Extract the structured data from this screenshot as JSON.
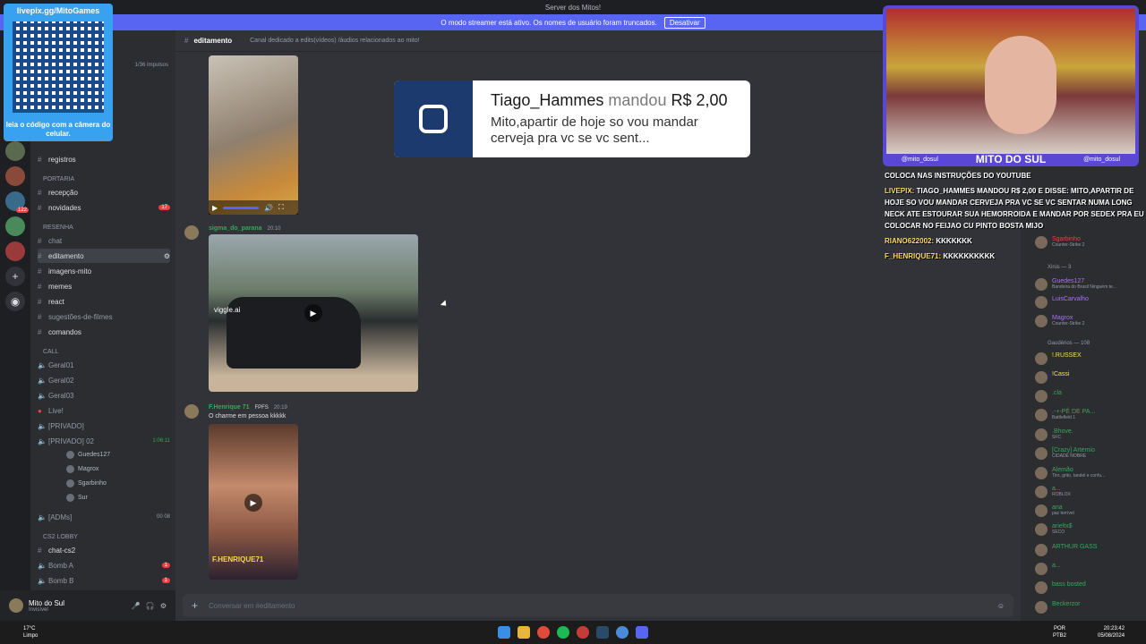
{
  "window": {
    "title": "Server dos Mitos!"
  },
  "banner": {
    "text": "O modo streamer está ativo. Os nomes de usuário foram truncados.",
    "button": "Desativar"
  },
  "header": {
    "channel": "editamento",
    "description": "Canal dedicado a edits(vídeos) /áudios relacionados ao mito!"
  },
  "sidebar": {
    "boosts": "1/36 Impulsos",
    "channels": [
      {
        "name": "registros"
      },
      {
        "category": "PORTARIA"
      },
      {
        "name": "recepção"
      },
      {
        "name": "novidades",
        "badge": "17"
      },
      {
        "category": "RESENHA"
      },
      {
        "name": "chat"
      },
      {
        "name": "editamento"
      },
      {
        "name": "imagens-mito"
      },
      {
        "name": "memes"
      },
      {
        "name": "react"
      },
      {
        "name": "sugestões-de-filmes"
      },
      {
        "name": "comandos"
      },
      {
        "category": "CALL"
      },
      {
        "name": "Geral01"
      },
      {
        "name": "Geral02"
      },
      {
        "name": "Geral03"
      },
      {
        "name": "Live!"
      },
      {
        "name": "[PRIVADO]"
      },
      {
        "name": "[PRIVADO] 02",
        "timer": "1:06:11"
      },
      {
        "name": "[ADMs]",
        "timer": "00 08"
      },
      {
        "category": "CS2 LOBBY"
      },
      {
        "name": "chat-cs2"
      },
      {
        "name": "Bomb A"
      },
      {
        "name": "Bomb B"
      }
    ],
    "voice_users": [
      "Guedes127",
      "Magrox",
      "Sgarbinho",
      "Sur"
    ]
  },
  "messages": [
    {
      "author": "sigma_do_parana",
      "time": "20:10",
      "text": "",
      "watermark": "viggle.ai"
    },
    {
      "author": "F.Henrique 71",
      "tag": "FPFS",
      "time": "20:19",
      "text": "O charme em pessoa kkkkk",
      "watermark": "F.HENRIQUE71"
    }
  ],
  "composer": {
    "placeholder": "Conversar em #editamento"
  },
  "user": {
    "name": "Mito do Sul",
    "status": "Invisível"
  },
  "members": {
    "group_online": "Xirús — 3",
    "group_offline": "Gaudérios — 108",
    "list": [
      {
        "name": "Sgarbinho",
        "activity": "Counter-Strike 2",
        "color": "#f23f43"
      },
      {
        "name": "Guedes127",
        "activity": "Bandeira do Brasil Ninguém te...",
        "color": "#a970ff"
      },
      {
        "name": "LuisCarvalho",
        "activity": "",
        "color": "#a970ff"
      },
      {
        "name": "Magrox",
        "activity": "Counter-Strike 2",
        "color": "#a970ff"
      },
      {
        "name": "!.RUSSEX",
        "activity": "",
        "color": "#f0e05a"
      },
      {
        "name": "!Cassi",
        "activity": "",
        "color": "#f0e05a"
      },
      {
        "name": ".cla",
        "activity": "",
        "color": "#3ba55c"
      },
      {
        "name": ".-+-PÉ DE PA...",
        "activity": "Battlefield 1",
        "color": "#3ba55c"
      },
      {
        "name": ".Bhove.",
        "activity": "SFC",
        "color": "#3ba55c"
      },
      {
        "name": "[Crazy] Artemio",
        "activity": "CIDADE NOBRE",
        "color": "#3ba55c"
      },
      {
        "name": "Alemão",
        "activity": "Tiro, grito, tandel e confu...",
        "color": "#3ba55c"
      },
      {
        "name": "a...",
        "activity": "ROBLOX",
        "color": "#3ba55c"
      },
      {
        "name": "ana",
        "activity": "paz terrível",
        "color": "#3ba55c"
      },
      {
        "name": "arieltx$",
        "activity": "SECO",
        "color": "#3ba55c"
      },
      {
        "name": "ARTHUR GASS",
        "activity": "",
        "color": "#3ba55c"
      },
      {
        "name": "a...",
        "activity": "",
        "color": "#3ba55c"
      },
      {
        "name": "bass bosted",
        "activity": "",
        "color": "#3ba55c"
      },
      {
        "name": "Beckerzor",
        "activity": "",
        "color": "#3ba55c"
      }
    ]
  },
  "overlay": {
    "qr_header": "livepix.gg/MitoGames",
    "qr_footer": "leia o código com a câmera do celular.",
    "donation_name": "Tiago_Hammes",
    "donation_verb": "mandou",
    "donation_amount": "R$ 2,00",
    "donation_message": "Mito,apartir de hoje so vou mandar cerveja pra vc se vc sent...",
    "cam_handle_left": "@mito_dosul",
    "cam_title": "MITO DO SUL",
    "cam_handle_right": "@mito_dosul",
    "chat": [
      {
        "who": "",
        "text": "COLOCA NAS INSTRUÇÕES DO YOUTUBE"
      },
      {
        "who": "LIVEPIX:",
        "text": "TIAGO_HAMMES MANDOU R$ 2,00 E DISSE: MITO,APARTIR DE HOJE SO VOU MANDAR CERVEJA PRA VC SE VC SENTAR NUMA LONG NECK ATE ESTOURAR SUA HEMORROIDA E MANDAR POR SEDEX PRA EU COLOCAR NO FEIJAO CU PINTO BOSTA MIJO"
      },
      {
        "who": "RIANO622002:",
        "text": "KKKKKKK"
      },
      {
        "who": "F_HENRIQUE71:",
        "text": "KKKKKKKKKK"
      }
    ]
  },
  "taskbar": {
    "weather": "17°C",
    "weather_sub": "Limpo",
    "lang": "POR",
    "lang_sub": "PTB2",
    "time": "20:23:42",
    "date": "05/08/2024"
  },
  "colors": {
    "accent": "#5865f2",
    "bg": "#313338",
    "sidebar": "#2b2d31"
  }
}
